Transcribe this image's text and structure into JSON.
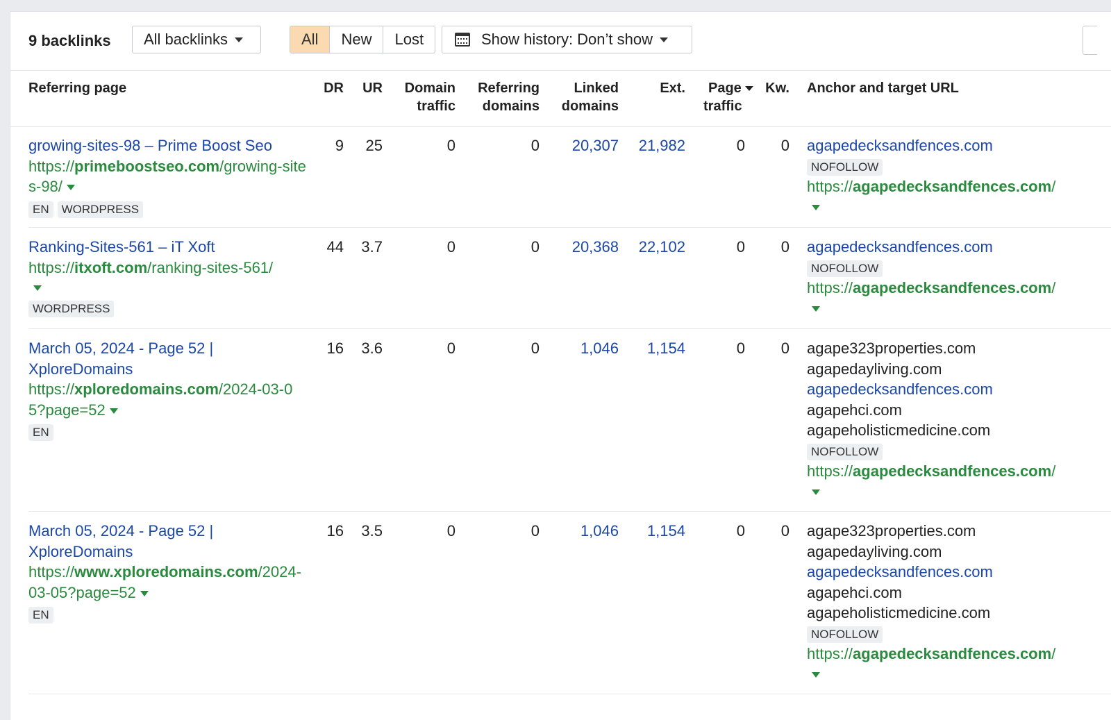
{
  "toolbar": {
    "count": "9 backlinks",
    "filter_label": "All backlinks",
    "segments": [
      "All",
      "New",
      "Lost"
    ],
    "history_label": "Show history: Don’t show"
  },
  "columns": {
    "referring_page": "Referring page",
    "dr": "DR",
    "ur": "UR",
    "domain_traffic_1": "Domain",
    "domain_traffic_2": "traffic",
    "referring_domains_1": "Referring",
    "referring_domains_2": "domains",
    "linked_domains_1": "Linked",
    "linked_domains_2": "domains",
    "ext": "Ext.",
    "page_traffic_1": "Page",
    "page_traffic_2": "traffic",
    "kw": "Kw.",
    "anchor": "Anchor and target URL"
  },
  "rows": [
    {
      "title": "growing-sites-98 – Prime Boost Seo",
      "url_prefix": "https://",
      "url_domain": "primeboostseo.com",
      "url_path": "/growing-sites-98/",
      "tags": [
        "EN",
        "WORDPRESS"
      ],
      "dr": "9",
      "ur": "25",
      "domain_traffic": "0",
      "referring_domains": "0",
      "linked_domains": "20,307",
      "ext": "21,982",
      "page_traffic": "0",
      "kw": "0",
      "anchor_links": [
        {
          "text": "agapedecksandfences.com",
          "link": true
        }
      ],
      "rel": "NOFOLLOW",
      "target_prefix": "https://",
      "target_domain": "agapedecksandfences.com",
      "target_path": "/"
    },
    {
      "title": "Ranking-Sites-561 – iT Xoft",
      "url_prefix": "https://",
      "url_domain": "itxoft.com",
      "url_path": "/ranking-sites-561/",
      "tags": [
        "WORDPRESS"
      ],
      "dr": "44",
      "ur": "3.7",
      "domain_traffic": "0",
      "referring_domains": "0",
      "linked_domains": "20,368",
      "ext": "22,102",
      "page_traffic": "0",
      "kw": "0",
      "anchor_links": [
        {
          "text": "agapedecksandfences.com",
          "link": true
        }
      ],
      "rel": "NOFOLLOW",
      "target_prefix": "https://",
      "target_domain": "agapedecksandfences.com",
      "target_path": "/"
    },
    {
      "title": "March 05, 2024 - Page 52 | XploreDomains",
      "url_prefix": "https://",
      "url_domain": "xploredomains.com",
      "url_path": "/2024-03-05?page=52",
      "tags": [
        "EN"
      ],
      "dr": "16",
      "ur": "3.6",
      "domain_traffic": "0",
      "referring_domains": "0",
      "linked_domains": "1,046",
      "ext": "1,154",
      "page_traffic": "0",
      "kw": "0",
      "anchor_links": [
        {
          "text": "agape323properties.com",
          "link": false
        },
        {
          "text": "agapedayliving.com",
          "link": false
        },
        {
          "text": "agapedecksandfences.com",
          "link": true
        },
        {
          "text": "agapehci.com",
          "link": false
        },
        {
          "text": "agapeholisticmedicine.com",
          "link": false
        }
      ],
      "rel": "NOFOLLOW",
      "target_prefix": "https://",
      "target_domain": "agapedecksandfences.com",
      "target_path": "/"
    },
    {
      "title": "March 05, 2024 - Page 52 | XploreDomains",
      "url_prefix": "https://",
      "url_domain": "www.xploredomains.com",
      "url_path": "/2024-03-05?page=52",
      "tags": [
        "EN"
      ],
      "dr": "16",
      "ur": "3.5",
      "domain_traffic": "0",
      "referring_domains": "0",
      "linked_domains": "1,046",
      "ext": "1,154",
      "page_traffic": "0",
      "kw": "0",
      "anchor_links": [
        {
          "text": "agape323properties.com",
          "link": false
        },
        {
          "text": "agapedayliving.com",
          "link": false
        },
        {
          "text": "agapedecksandfences.com",
          "link": true
        },
        {
          "text": "agapehci.com",
          "link": false
        },
        {
          "text": "agapeholisticmedicine.com",
          "link": false
        }
      ],
      "rel": "NOFOLLOW",
      "target_prefix": "https://",
      "target_domain": "agapedecksandfences.com",
      "target_path": "/"
    }
  ],
  "icons": {
    "calendar": "calendar-icon",
    "dropdown": "chevron-down-icon"
  },
  "colors": {
    "link_blue": "#1b47a8",
    "url_green": "#2a8a3e",
    "active_segment": "#fbd9b1"
  }
}
